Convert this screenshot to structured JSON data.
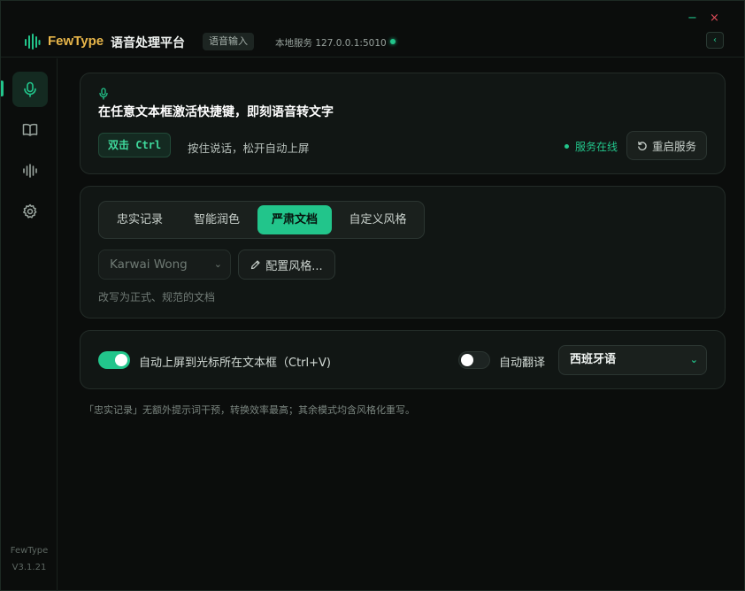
{
  "app": {
    "brand": "FewType",
    "platform": "语音处理平台",
    "tag": "语音输入",
    "service": "本地服务 127.0.0.1:5010",
    "window_controls": {
      "minimize": "−",
      "close": "×",
      "collapse": "‹"
    }
  },
  "sidebar": {
    "items": [
      {
        "icon": "mic-icon",
        "active": true
      },
      {
        "icon": "book-icon",
        "active": false
      },
      {
        "icon": "waveform-icon",
        "active": false
      },
      {
        "icon": "gear-icon",
        "active": false
      }
    ],
    "footer_name": "FewType",
    "footer_version": "V3.1.21"
  },
  "hotkey_card": {
    "headline": "在任意文本框激活快捷键，即刻语音转文字",
    "hotkey": "双击 Ctrl",
    "hotkey_hint": "按住说话，松开自动上屏",
    "status": "服务在线",
    "restart_label": "重启服务"
  },
  "style_card": {
    "tabs": [
      {
        "label": "忠实记录",
        "active": false
      },
      {
        "label": "智能润色",
        "active": false
      },
      {
        "label": "严肃文档",
        "active": true
      },
      {
        "label": "自定义风格",
        "active": false
      }
    ],
    "voice_select": "Karwai Wong",
    "config_label": "配置风格...",
    "description": "改写为正式、规范的文档"
  },
  "options_card": {
    "auto_paste_label": "自动上屏到光标所在文本框（Ctrl+V)",
    "auto_paste_on": true,
    "auto_translate_label": "自动翻译",
    "auto_translate_on": false,
    "language": "西班牙语"
  },
  "footnote": "「忠实记录」无额外提示词干预，转换效率最高；其余模式均含风格化重写。",
  "colors": {
    "accent": "#22c58b",
    "brand": "#e8b64a",
    "close": "#e04d5a"
  }
}
